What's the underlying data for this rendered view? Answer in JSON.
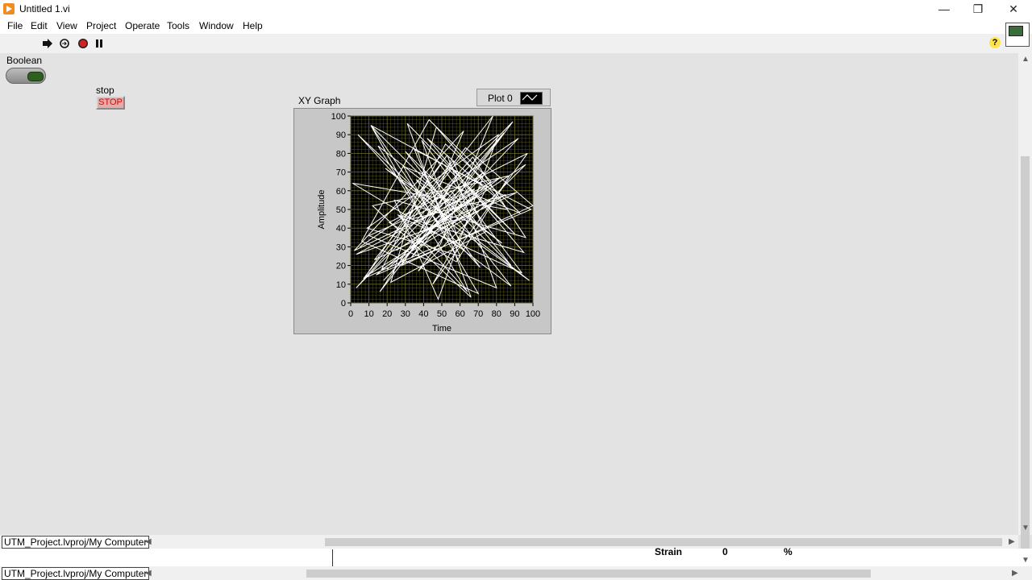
{
  "window": {
    "title": "Untitled 1.vi"
  },
  "menu": [
    "File",
    "Edit",
    "View",
    "Project",
    "Operate",
    "Tools",
    "Window",
    "Help"
  ],
  "toolbar": {
    "run": "run-arrow-icon",
    "run_continuously": "run-continuously-icon",
    "abort": "abort-icon",
    "pause": "pause-icon",
    "help": "?"
  },
  "controls": {
    "boolean_label": "Boolean",
    "stop_label": "stop",
    "stop_button_text": "STOP"
  },
  "graph": {
    "label": "XY Graph",
    "legend_plot": "Plot 0"
  },
  "chart_data": {
    "type": "line",
    "title": "",
    "xlabel": "Time",
    "ylabel": "Amplitude",
    "xlim": [
      0,
      100
    ],
    "ylim": [
      0,
      100
    ],
    "xticks": [
      0,
      10,
      20,
      30,
      40,
      50,
      60,
      70,
      80,
      90,
      100
    ],
    "yticks": [
      0,
      10,
      20,
      30,
      40,
      50,
      60,
      70,
      80,
      90,
      100
    ],
    "grid": true,
    "background": "#000000",
    "grid_color": "#6b6b2a",
    "series": [
      {
        "name": "Plot 0",
        "color": "#ffffff",
        "x": [
          5,
          92,
          18,
          73,
          40,
          11,
          88,
          55,
          3,
          67,
          96,
          24,
          48,
          81,
          9,
          60,
          35,
          99,
          14,
          77,
          43,
          6,
          70,
          29,
          93,
          52,
          17,
          85,
          38,
          62,
          2,
          75,
          45,
          97,
          21,
          58,
          87,
          12,
          66,
          31,
          90,
          50,
          8,
          79,
          42,
          95,
          26,
          64,
          15,
          83,
          36,
          71,
          4,
          57,
          98,
          19,
          46,
          89,
          33,
          68,
          10,
          80,
          53,
          27,
          94,
          39,
          61,
          1,
          86,
          47,
          22,
          74,
          56,
          13,
          91,
          34,
          78,
          49,
          7,
          63,
          100,
          28,
          59,
          16,
          84,
          41,
          69,
          25,
          96,
          37,
          72,
          11,
          54,
          88,
          30,
          65,
          3,
          82,
          44,
          20
        ],
        "y": [
          30,
          88,
          12,
          70,
          45,
          95,
          20,
          60,
          8,
          78,
          35,
          55,
          2,
          90,
          40,
          25,
          82,
          50,
          15,
          65,
          98,
          33,
          5,
          73,
          48,
          85,
          18,
          58,
          38,
          92,
          28,
          62,
          10,
          80,
          43,
          22,
          68,
          52,
          3,
          96,
          37,
          75,
          14,
          57,
          88,
          27,
          47,
          6,
          84,
          32,
          66,
          19,
          90,
          41,
          12,
          72,
          54,
          97,
          24,
          61,
          36,
          8,
          79,
          46,
          16,
          87,
          29,
          64,
          50,
          94,
          11,
          38,
          76,
          23,
          59,
          45,
          100,
          31,
          13,
          83,
          52,
          20,
          69,
          6,
          91,
          42,
          57,
          28,
          74,
          17,
          63,
          95,
          34,
          9,
          81,
          47,
          26,
          67,
          39,
          18
        ]
      }
    ]
  },
  "status": {
    "project_path_1": "UTM_Project.lvproj/My Computer",
    "project_path_2": "UTM_Project.lvproj/My Computer",
    "strain_label": "Strain",
    "strain_value": "0",
    "strain_unit": "%"
  }
}
